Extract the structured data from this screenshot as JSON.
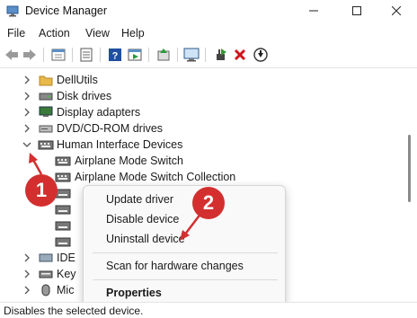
{
  "window": {
    "title": "Device Manager",
    "app_icon": "device-manager-icon",
    "controls": [
      "minimize-icon",
      "maximize-icon",
      "close-icon"
    ]
  },
  "menu": [
    "File",
    "Action",
    "View",
    "Help"
  ],
  "toolbar": {
    "icons": [
      "back-arrow-icon",
      "forward-arrow-icon",
      "properties-sheet-icon",
      "list-icon",
      "help-icon",
      "run-icon",
      "update-driver-icon",
      "scan-monitor-icon",
      "enable-device-icon",
      "uninstall-x-icon",
      "download-arrow-icon"
    ]
  },
  "tree": {
    "categories": [
      {
        "label": "DellUtils",
        "icon": "folder-icon",
        "expanded": false
      },
      {
        "label": "Disk drives",
        "icon": "disk-drive-icon",
        "expanded": false
      },
      {
        "label": "Display adapters",
        "icon": "display-adapter-icon",
        "expanded": false
      },
      {
        "label": "DVD/CD-ROM drives",
        "icon": "dvd-drive-icon",
        "expanded": false
      },
      {
        "label": "Human Interface Devices",
        "icon": "hid-icon",
        "expanded": true
      }
    ],
    "hid_children": [
      {
        "label": "Airplane Mode Switch",
        "icon": "hid-device-icon"
      },
      {
        "label": "Airplane Mode Switch Collection",
        "icon": "hid-device-icon"
      }
    ],
    "partial_rows": [
      {
        "label": "IDE",
        "icon": "ide-controller-icon"
      },
      {
        "label": "Key",
        "icon": "keyboard-icon"
      },
      {
        "label": "Mic",
        "icon": "mouse-icon"
      }
    ]
  },
  "context_menu": {
    "items": [
      "Update driver",
      "Disable device",
      "Uninstall device",
      "Scan for hardware changes",
      "Properties"
    ]
  },
  "annotations": [
    "1",
    "2"
  ],
  "colors": {
    "accent": "#d32f2f",
    "folder": "#e8b84a",
    "help_blue": "#1f4fa0"
  },
  "status_text": "Disables the selected device."
}
